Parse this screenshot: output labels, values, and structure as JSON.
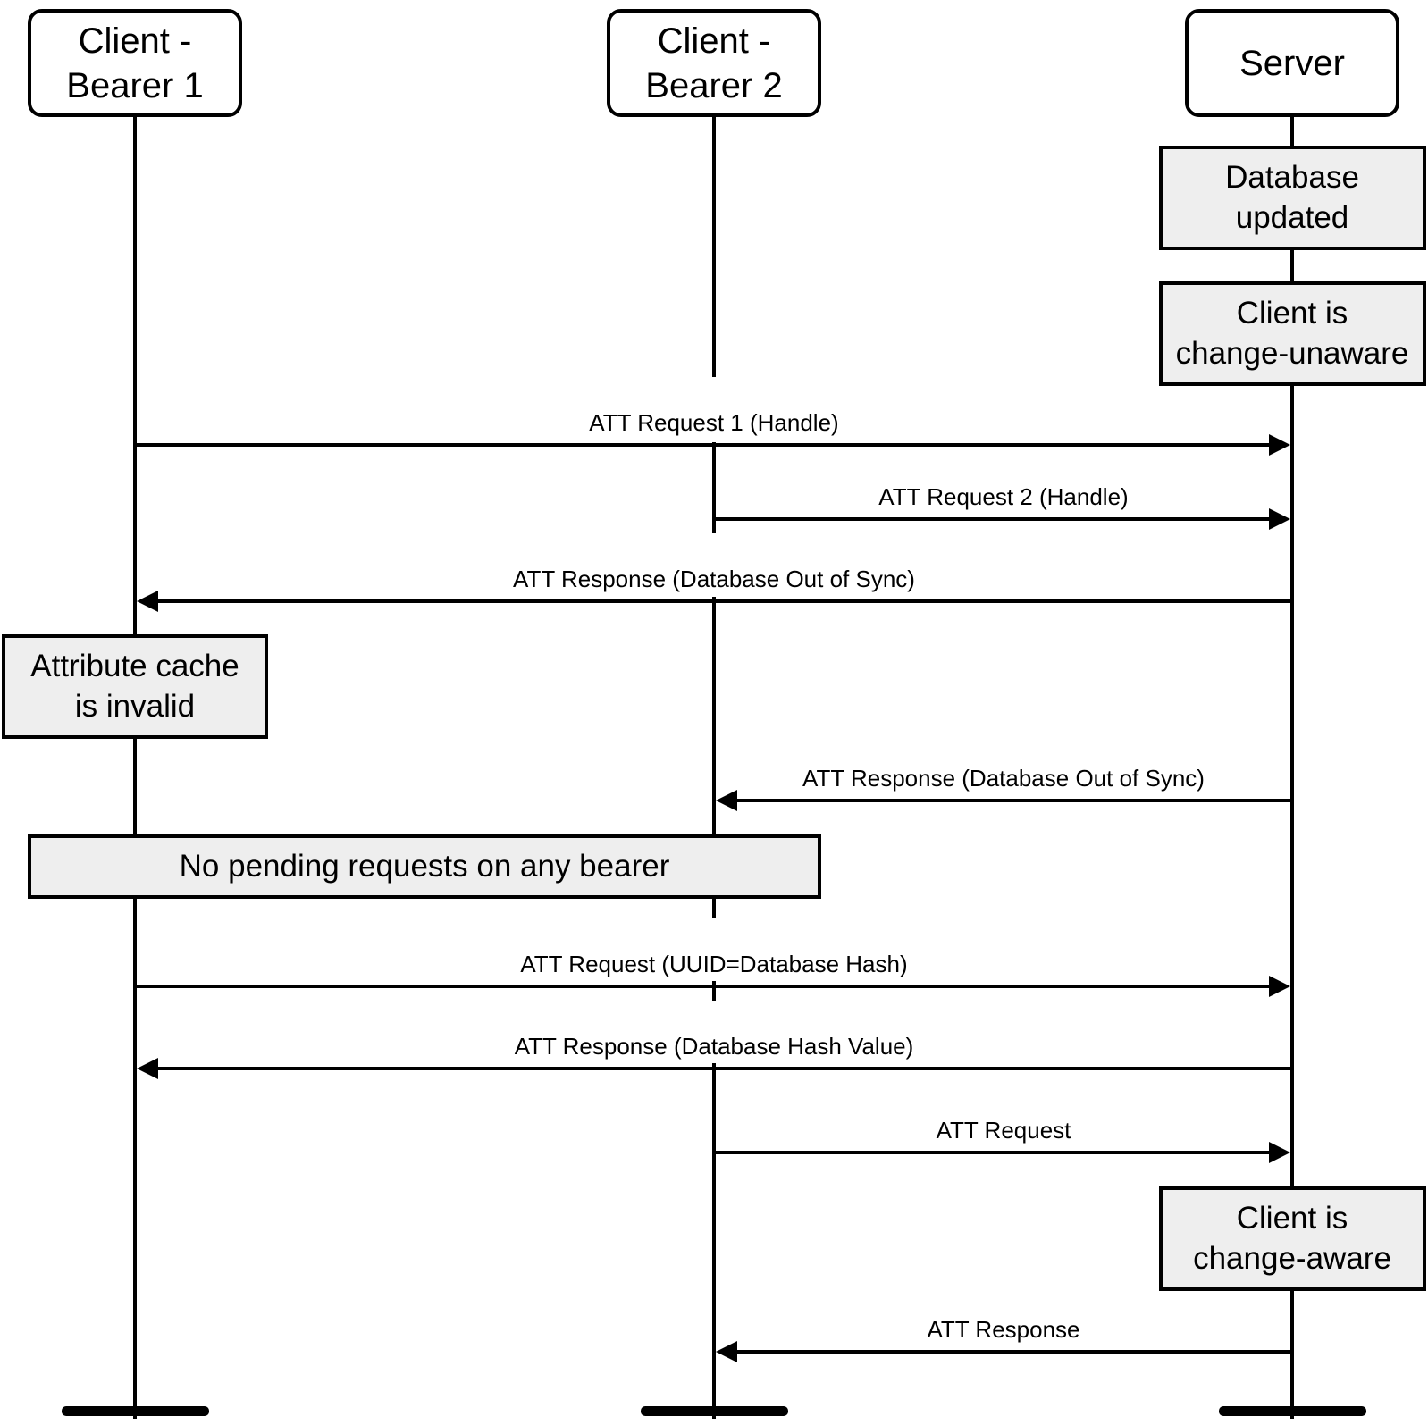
{
  "diagram": {
    "type": "sequence",
    "colors": {
      "line": "#000000",
      "note_fill": "#eeeeee",
      "background": "#ffffff"
    },
    "actors": [
      {
        "id": "c1",
        "lines": [
          "Client -",
          "Bearer 1"
        ]
      },
      {
        "id": "c2",
        "lines": [
          "Client -",
          "Bearer 2"
        ]
      },
      {
        "id": "srv",
        "lines": [
          "Server"
        ]
      }
    ],
    "notes": [
      {
        "id": "db-updated",
        "over": "srv",
        "lines": [
          "Database",
          "updated"
        ]
      },
      {
        "id": "change-unaware",
        "over": "srv",
        "lines": [
          "Client is",
          "change-unaware"
        ]
      },
      {
        "id": "cache-invalid",
        "over": "c1",
        "lines": [
          "Attribute cache",
          "is invalid"
        ]
      },
      {
        "id": "no-pending",
        "over": "c1-c2",
        "lines": [
          "No pending requests on any bearer"
        ]
      },
      {
        "id": "change-aware",
        "over": "srv",
        "lines": [
          "Client is",
          "change-aware"
        ]
      }
    ],
    "messages": [
      {
        "from": "c1",
        "to": "srv",
        "label": "ATT Request 1 (Handle)"
      },
      {
        "from": "c2",
        "to": "srv",
        "label": "ATT Request 2 (Handle)"
      },
      {
        "from": "srv",
        "to": "c1",
        "label": "ATT Response (Database Out of Sync)"
      },
      {
        "from": "srv",
        "to": "c2",
        "label": "ATT Response (Database Out of Sync)"
      },
      {
        "from": "c1",
        "to": "srv",
        "label": "ATT Request (UUID=Database Hash)"
      },
      {
        "from": "srv",
        "to": "c1",
        "label": "ATT Response (Database Hash Value)"
      },
      {
        "from": "c2",
        "to": "srv",
        "label": "ATT Request"
      },
      {
        "from": "srv",
        "to": "c2",
        "label": "ATT Response"
      }
    ]
  }
}
